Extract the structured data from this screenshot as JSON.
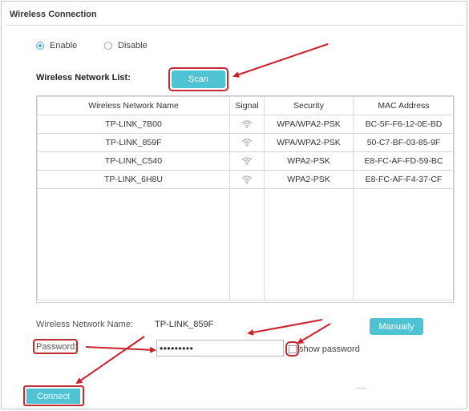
{
  "section": {
    "title": "Wireless Connection"
  },
  "mode": {
    "enable_label": "Enable",
    "disable_label": "Disable",
    "selected": "Enable"
  },
  "list": {
    "label": "Wireless Network List:",
    "scan_label": "Scan",
    "columns": [
      "Wireless Network Name",
      "Signal",
      "Security",
      "MAC Address"
    ],
    "rows": [
      {
        "name": "TP-LINK_7B00",
        "signal": "wifi-signal-icon",
        "security": "WPA/WPA2-PSK",
        "mac": "BC-5F-F6-12-0E-BD"
      },
      {
        "name": "TP-LINK_859F",
        "signal": "wifi-signal-icon",
        "security": "WPA/WPA2-PSK",
        "mac": "50-C7-BF-03-85-9F"
      },
      {
        "name": "TP-LINK_C540",
        "signal": "wifi-signal-icon",
        "security": "WPA2-PSK",
        "mac": "E8-FC-AF-FD-59-BC"
      },
      {
        "name": "TP-LINK_6H8U",
        "signal": "wifi-signal-icon",
        "security": "WPA2-PSK",
        "mac": "E8-FC-AF-F4-37-CF"
      }
    ]
  },
  "form": {
    "network_name_label": "Wireless Network Name:",
    "network_name_value": "TP-LINK_859F",
    "manually_label": "Manually",
    "password_label": "Password:",
    "password_value": "•••••••••",
    "show_password_label": "show password",
    "connect_label": "Connect"
  },
  "colors": {
    "accent": "#4fc3d3",
    "highlight": "#c22a34",
    "radio": "#3fa9d6"
  }
}
